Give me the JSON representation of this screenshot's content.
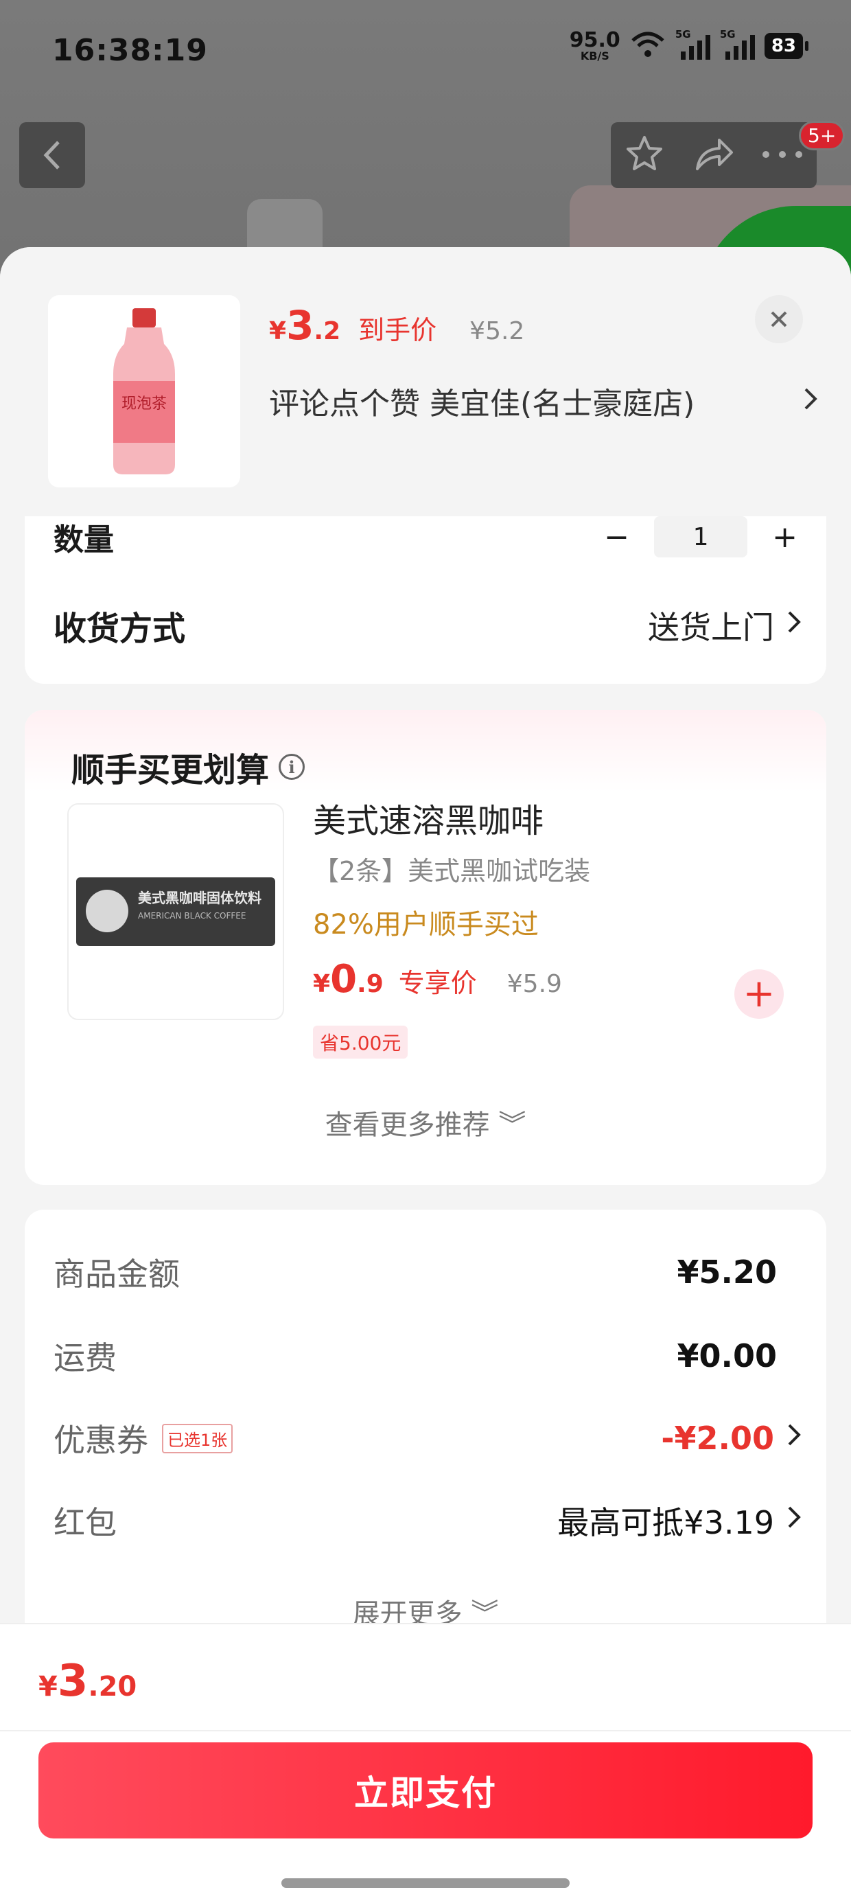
{
  "status_bar": {
    "time": "16:38:19",
    "net_speed": "95.0",
    "net_unit": "KB/S",
    "sim1": "5G",
    "sim2": "5G",
    "battery": "83"
  },
  "nav": {
    "badge": "5+"
  },
  "product": {
    "price_symbol": "¥",
    "price_int": "3",
    "price_dec": ".2",
    "price_tag": "到手价",
    "original_price": "¥5.2",
    "store_name": "评论点个赞 美宜佳(名士豪庭店)",
    "thumb_text": "现泡茶"
  },
  "quantity": {
    "label": "数量",
    "minus": "−",
    "value": "1",
    "plus": "+"
  },
  "shipping": {
    "label": "收货方式",
    "value": "送货上门"
  },
  "recommend": {
    "title": "顺手买更划算",
    "item_name": "美式速溶黑咖啡",
    "item_desc": "【2条】美式黑咖试吃装",
    "bought_text": "82%用户顺手买过",
    "price_symbol": "¥",
    "price_int": "0",
    "price_dec": ".9",
    "price_tag": "专享价",
    "original_price": "¥5.9",
    "save_tag": "省5.00元",
    "pack_text": "美式黑咖啡固体饮料",
    "pack_sub": "AMERICAN BLACK COFFEE",
    "add_label": "+",
    "more_label": "查看更多推荐 ︾"
  },
  "summary": {
    "goods_label": "商品金额",
    "goods_value": "¥5.20",
    "freight_label": "运费",
    "freight_value": "¥0.00",
    "coupon_label": "优惠券",
    "coupon_badge": "已选1张",
    "coupon_value": "-¥2.00",
    "redpacket_label": "红包",
    "redpacket_value": "最高可抵¥3.19",
    "expand_label": "展开更多 ︾"
  },
  "footer": {
    "total_symbol": "¥",
    "total_int": "3",
    "total_dec": ".20",
    "pay_label": "立即支付"
  },
  "colors": {
    "accent": "#e8342e",
    "pay_button": "#ff2a3a",
    "highlight": "#c98a1e"
  }
}
